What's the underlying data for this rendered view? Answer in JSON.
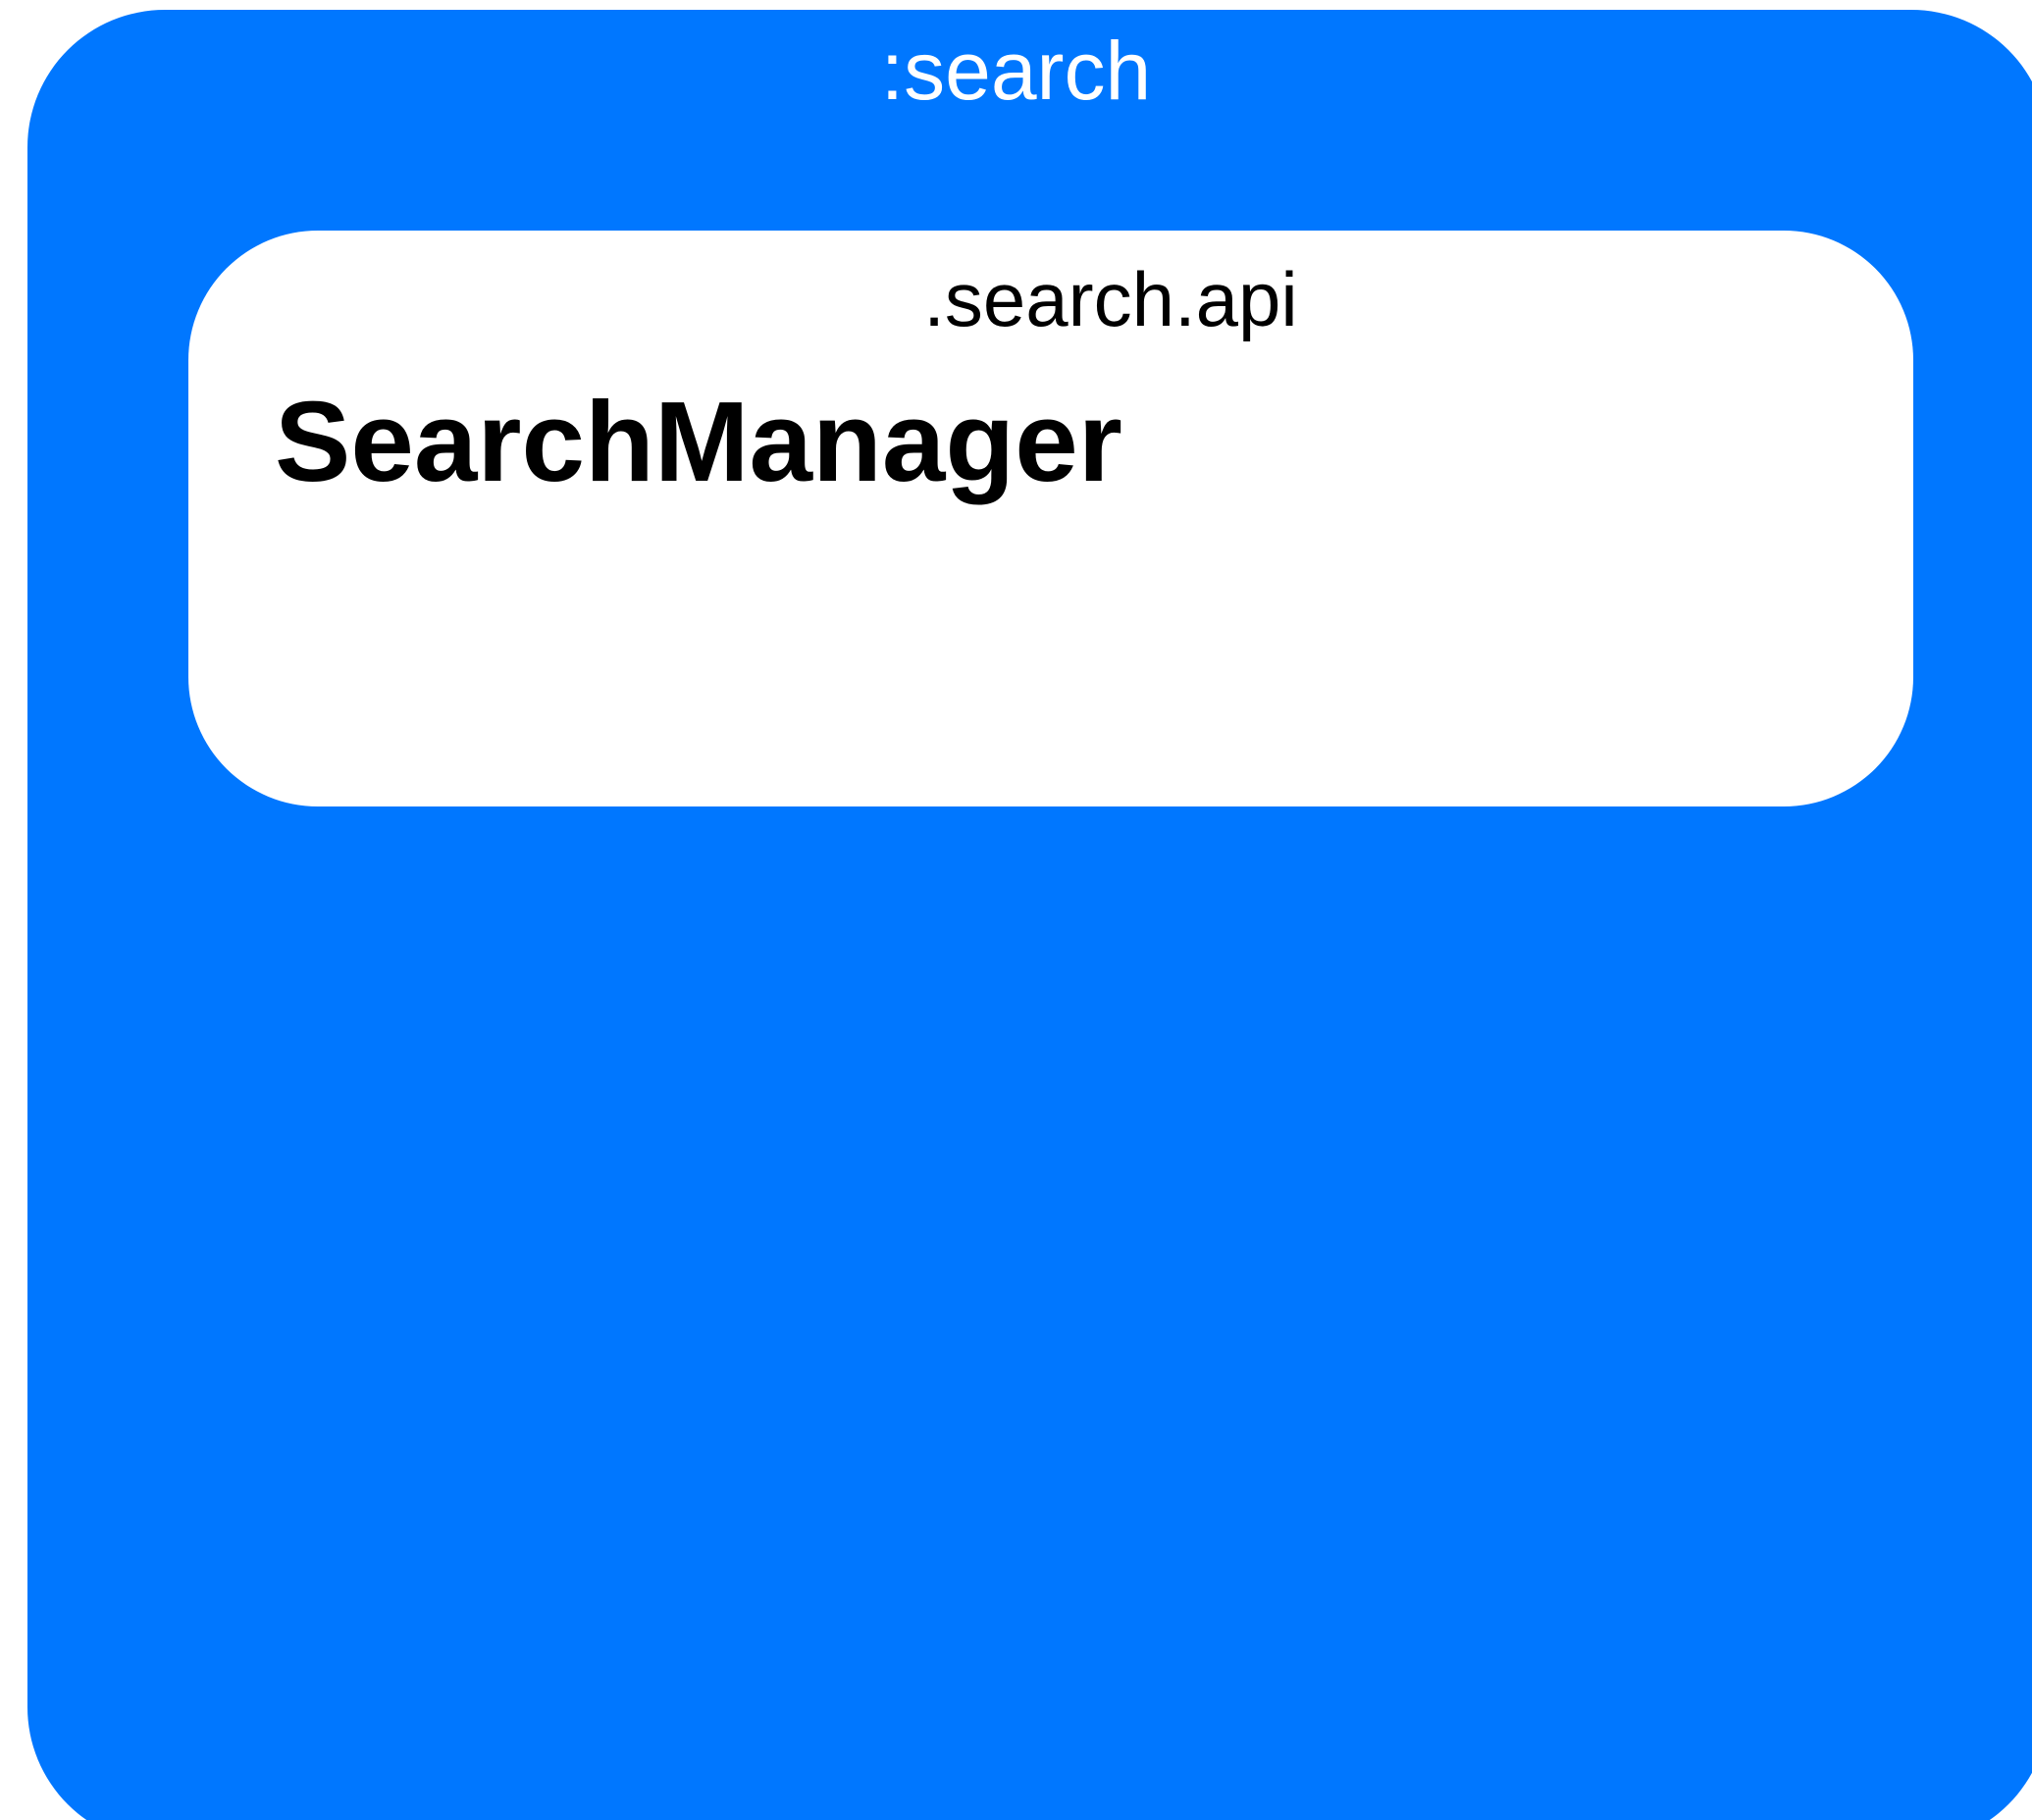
{
  "colors": {
    "module_fill": "#0077ff",
    "package_fill": "#ffffff",
    "module_text": "#ffffff",
    "package_text": "#000000"
  },
  "module": {
    "title": ":search",
    "package": {
      "title": ".search.api",
      "class_name": "SearchManager"
    }
  }
}
